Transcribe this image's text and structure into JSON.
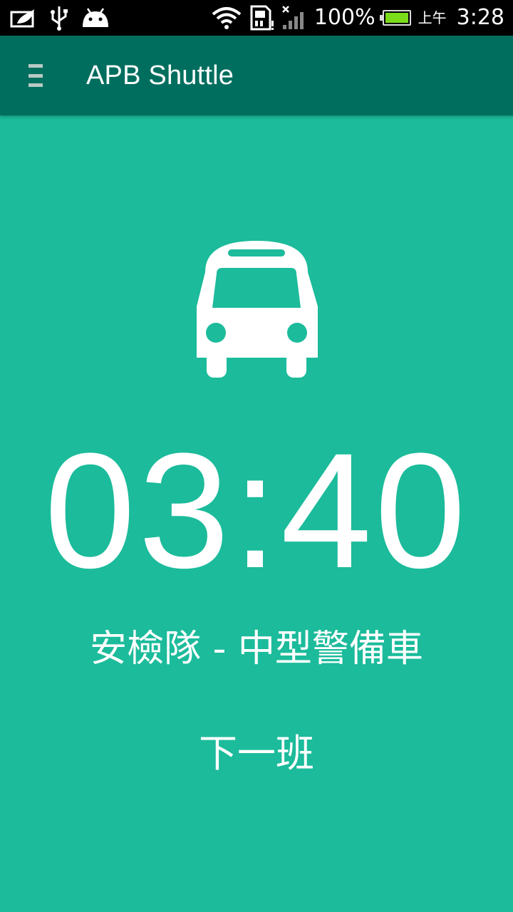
{
  "status_bar": {
    "battery_percent": "100%",
    "ampm": "上午",
    "clock": "3:28",
    "icons": [
      "picture-icon",
      "usb-icon",
      "android-icon",
      "wifi-icon",
      "sim-icon",
      "signal-icon",
      "battery-icon"
    ]
  },
  "app_bar": {
    "title": "APB Shuttle",
    "menu_icon": "menu-icon",
    "color": "#006e5e"
  },
  "main": {
    "background": "#1bbb9b",
    "icon": "bus-icon",
    "countdown": "03:40",
    "route": "安檢隊 - 中型警備車",
    "next_label": "下一班"
  }
}
